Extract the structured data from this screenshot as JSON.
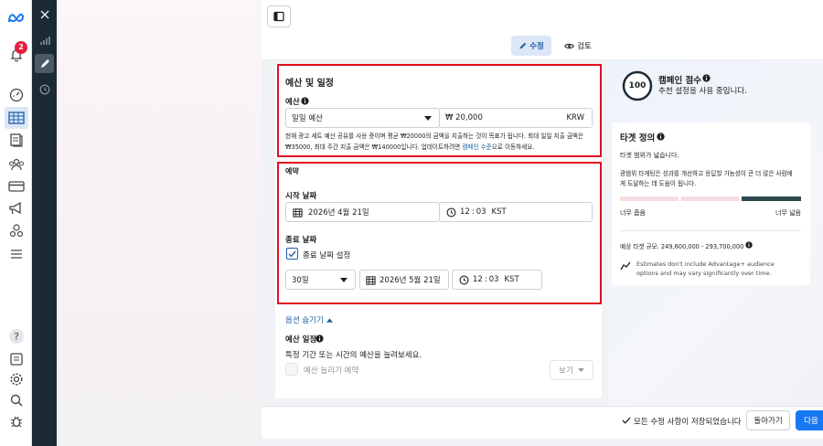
{
  "nav": {
    "notification_count": "2",
    "items": [
      "meta-logo",
      "notifications",
      "dashboard",
      "campaigns",
      "pages",
      "audiences",
      "billing",
      "ads",
      "ad-accounts",
      "menu"
    ],
    "bottom_items": [
      "help",
      "docs",
      "settings",
      "search",
      "debug"
    ]
  },
  "toolbar": {
    "edit_label": "수정",
    "review_label": "검토"
  },
  "budget": {
    "section_title": "예산 및 일정",
    "label": "예산",
    "type_value": "일일 예산",
    "amount_value": "₩ 20,000",
    "currency": "KRW",
    "note_line1": "현재 광고 세트 예산 공유를 사용 중이며 평균 ₩20000의 금액을 지출하는 것이 목표가 됩니다. 최대 일일 지출 금액은",
    "note_line2_pre": "₩35000, 최대 주간 지출 금액은 ₩140000입니다. 업데이트하려면 ",
    "note_link": "캠페인 수준",
    "note_line2_post": "으로 이동하세요."
  },
  "schedule": {
    "section_title": "예약",
    "start_label": "시작 날짜",
    "start_date": "2026년 4월 21일",
    "start_hour": "12",
    "start_min": "03",
    "start_tz": "KST",
    "time_sep": ":",
    "end_label": "종료 날짜",
    "end_checkbox_label": "종료 날짜 설정",
    "duration_value": "30일",
    "end_date": "2026년 5월 21일",
    "end_hour": "12",
    "end_min": "03",
    "end_tz": "KST"
  },
  "options": {
    "toggle_label": "옵션 숨기기",
    "budget_schedule_title": "예산 일정",
    "budget_schedule_desc": "특정 기간 또는 시간의 예산을 늘려보세요.",
    "increase_label": "예산 늘리기 예약",
    "view_label": "보기"
  },
  "campaign_score": {
    "score": "100",
    "title": "캠페인 점수",
    "desc": "추천 설정을 사용 중입니다."
  },
  "audience": {
    "title": "타겟 정의",
    "desc": "타겟 범위가 넓습니다.",
    "detail_line1": "광범위 타게팅은 성과를 개선하고 응답할 가능성이 큰 더 많은 사람에",
    "detail_line2": "게 도달하는 데 도움이 됩니다.",
    "narrow_label": "너무 좁음",
    "broad_label": "너무 넓음",
    "size_text": "예상 타겟 규모: 249,600,000 - 293,700,000",
    "estimate_line1": "Estimates don't include Advantage+ audience",
    "estimate_line2": "options and may vary significantly over time."
  },
  "footer": {
    "saved_text": "모든 수정 사항이 저장되었습니다",
    "back_label": "돌아가기",
    "next_label": "다음"
  },
  "colors": {
    "accent": "#1d5fa8",
    "highlight_border": "#e0101e",
    "rail": "#1c2b33",
    "primary_button": "#1877f2"
  }
}
